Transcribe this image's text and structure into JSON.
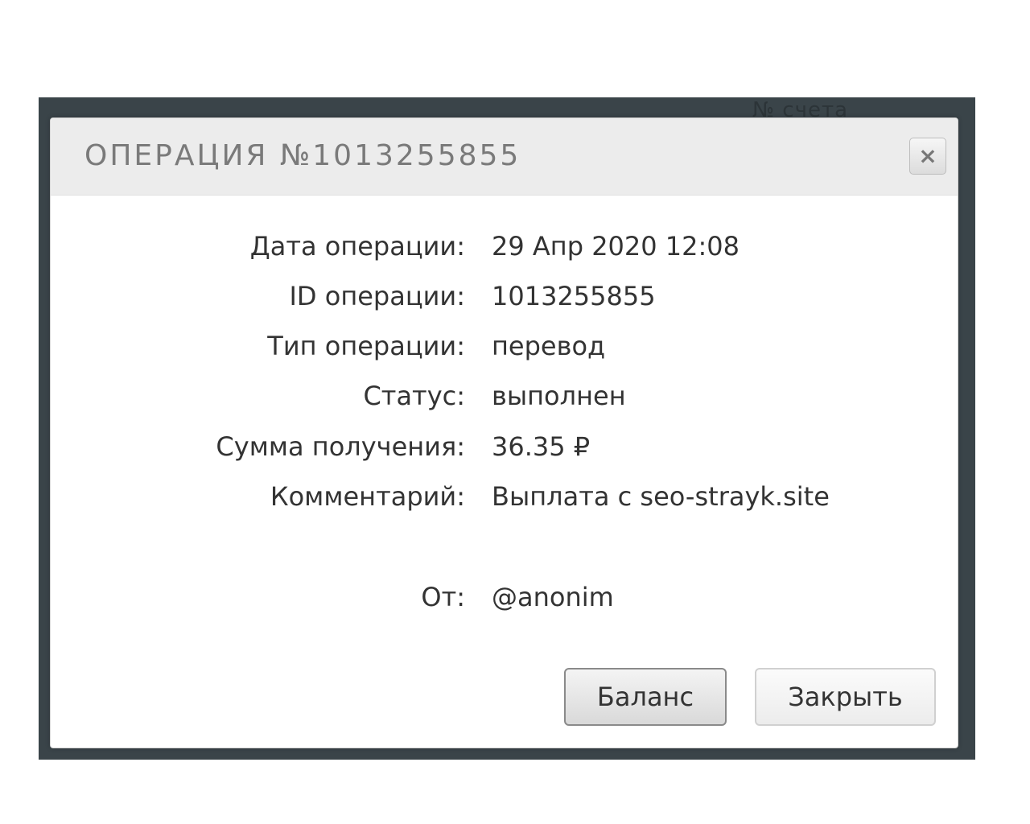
{
  "background": {
    "partial_text": "№ счета"
  },
  "dialog": {
    "title": "ОПЕРАЦИЯ №1013255855",
    "close_icon": "×",
    "details": [
      {
        "label": "Дата операции:",
        "value": "29 Апр 2020 12:08"
      },
      {
        "label": "ID операции:",
        "value": "1013255855"
      },
      {
        "label": "Тип операции:",
        "value": "перевод"
      },
      {
        "label": "Статус:",
        "value": "выполнен"
      },
      {
        "label": "Сумма получения:",
        "value": "36.35 ₽"
      },
      {
        "label": "Комментарий:",
        "value": "Выплата с seo-strayk.site"
      },
      {
        "label": "От:",
        "value": "@anonim"
      }
    ],
    "buttons": {
      "balance": "Баланс",
      "close": "Закрыть"
    }
  },
  "colors": {
    "backdrop": "#3a4449",
    "header": "#ececec",
    "text": "#333333",
    "title": "#7a7a7a"
  }
}
